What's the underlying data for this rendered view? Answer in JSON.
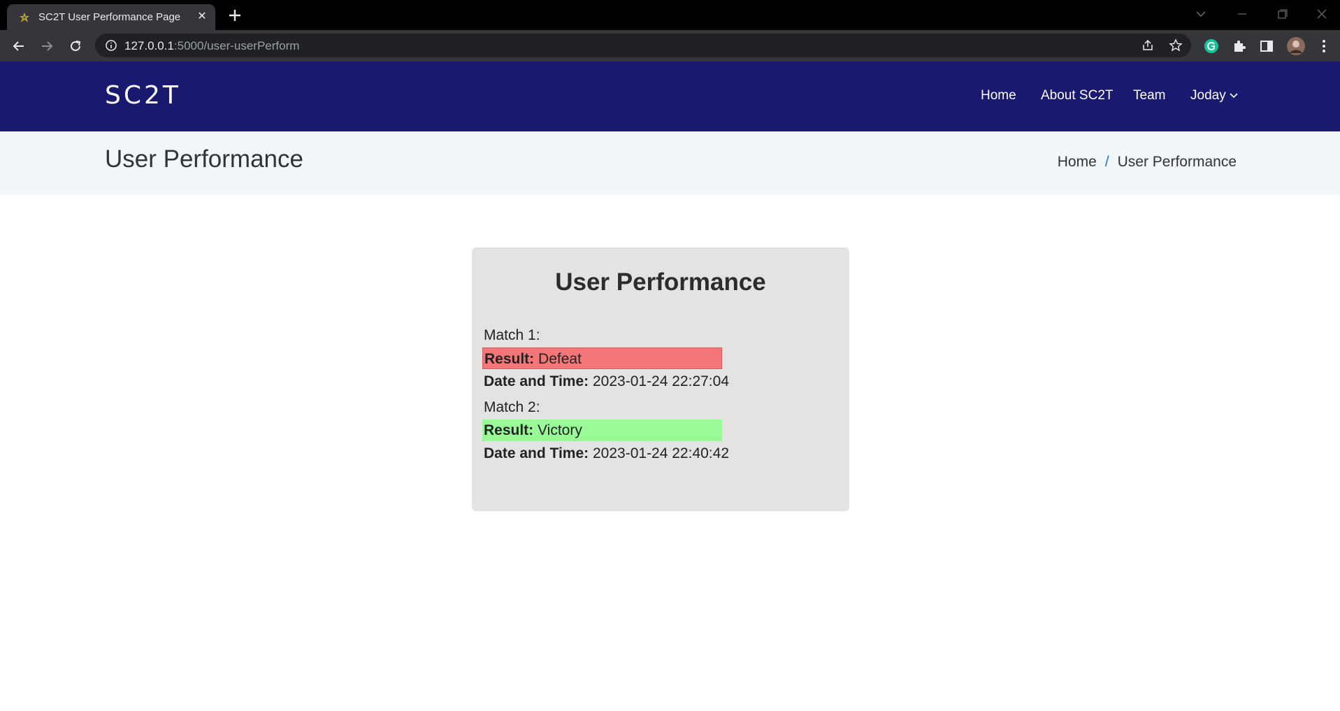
{
  "browser": {
    "tab_title": "SC2T User Performance Page",
    "url_host": "127.0.0.1",
    "url_path": ":5000/user-userPerform"
  },
  "site": {
    "logo": "SC2T",
    "nav": {
      "home": "Home",
      "about": "About SC2T",
      "team": "Team",
      "user": "Joday"
    }
  },
  "page": {
    "title": "User Performance",
    "breadcrumb": {
      "home": "Home",
      "current": "User Performance"
    }
  },
  "card": {
    "title": "User Performance",
    "result_label": "Result:",
    "datetime_label": "Date and Time:",
    "matches": [
      {
        "label": "Match 1:",
        "result": "Defeat",
        "datetime": "2023-01-24 22:27:04"
      },
      {
        "label": "Match 2:",
        "result": "Victory",
        "datetime": "2023-01-24 22:40:42"
      }
    ]
  },
  "colors": {
    "header_bg": "#191970",
    "defeat": "#f47678",
    "victory": "#98fb98"
  }
}
